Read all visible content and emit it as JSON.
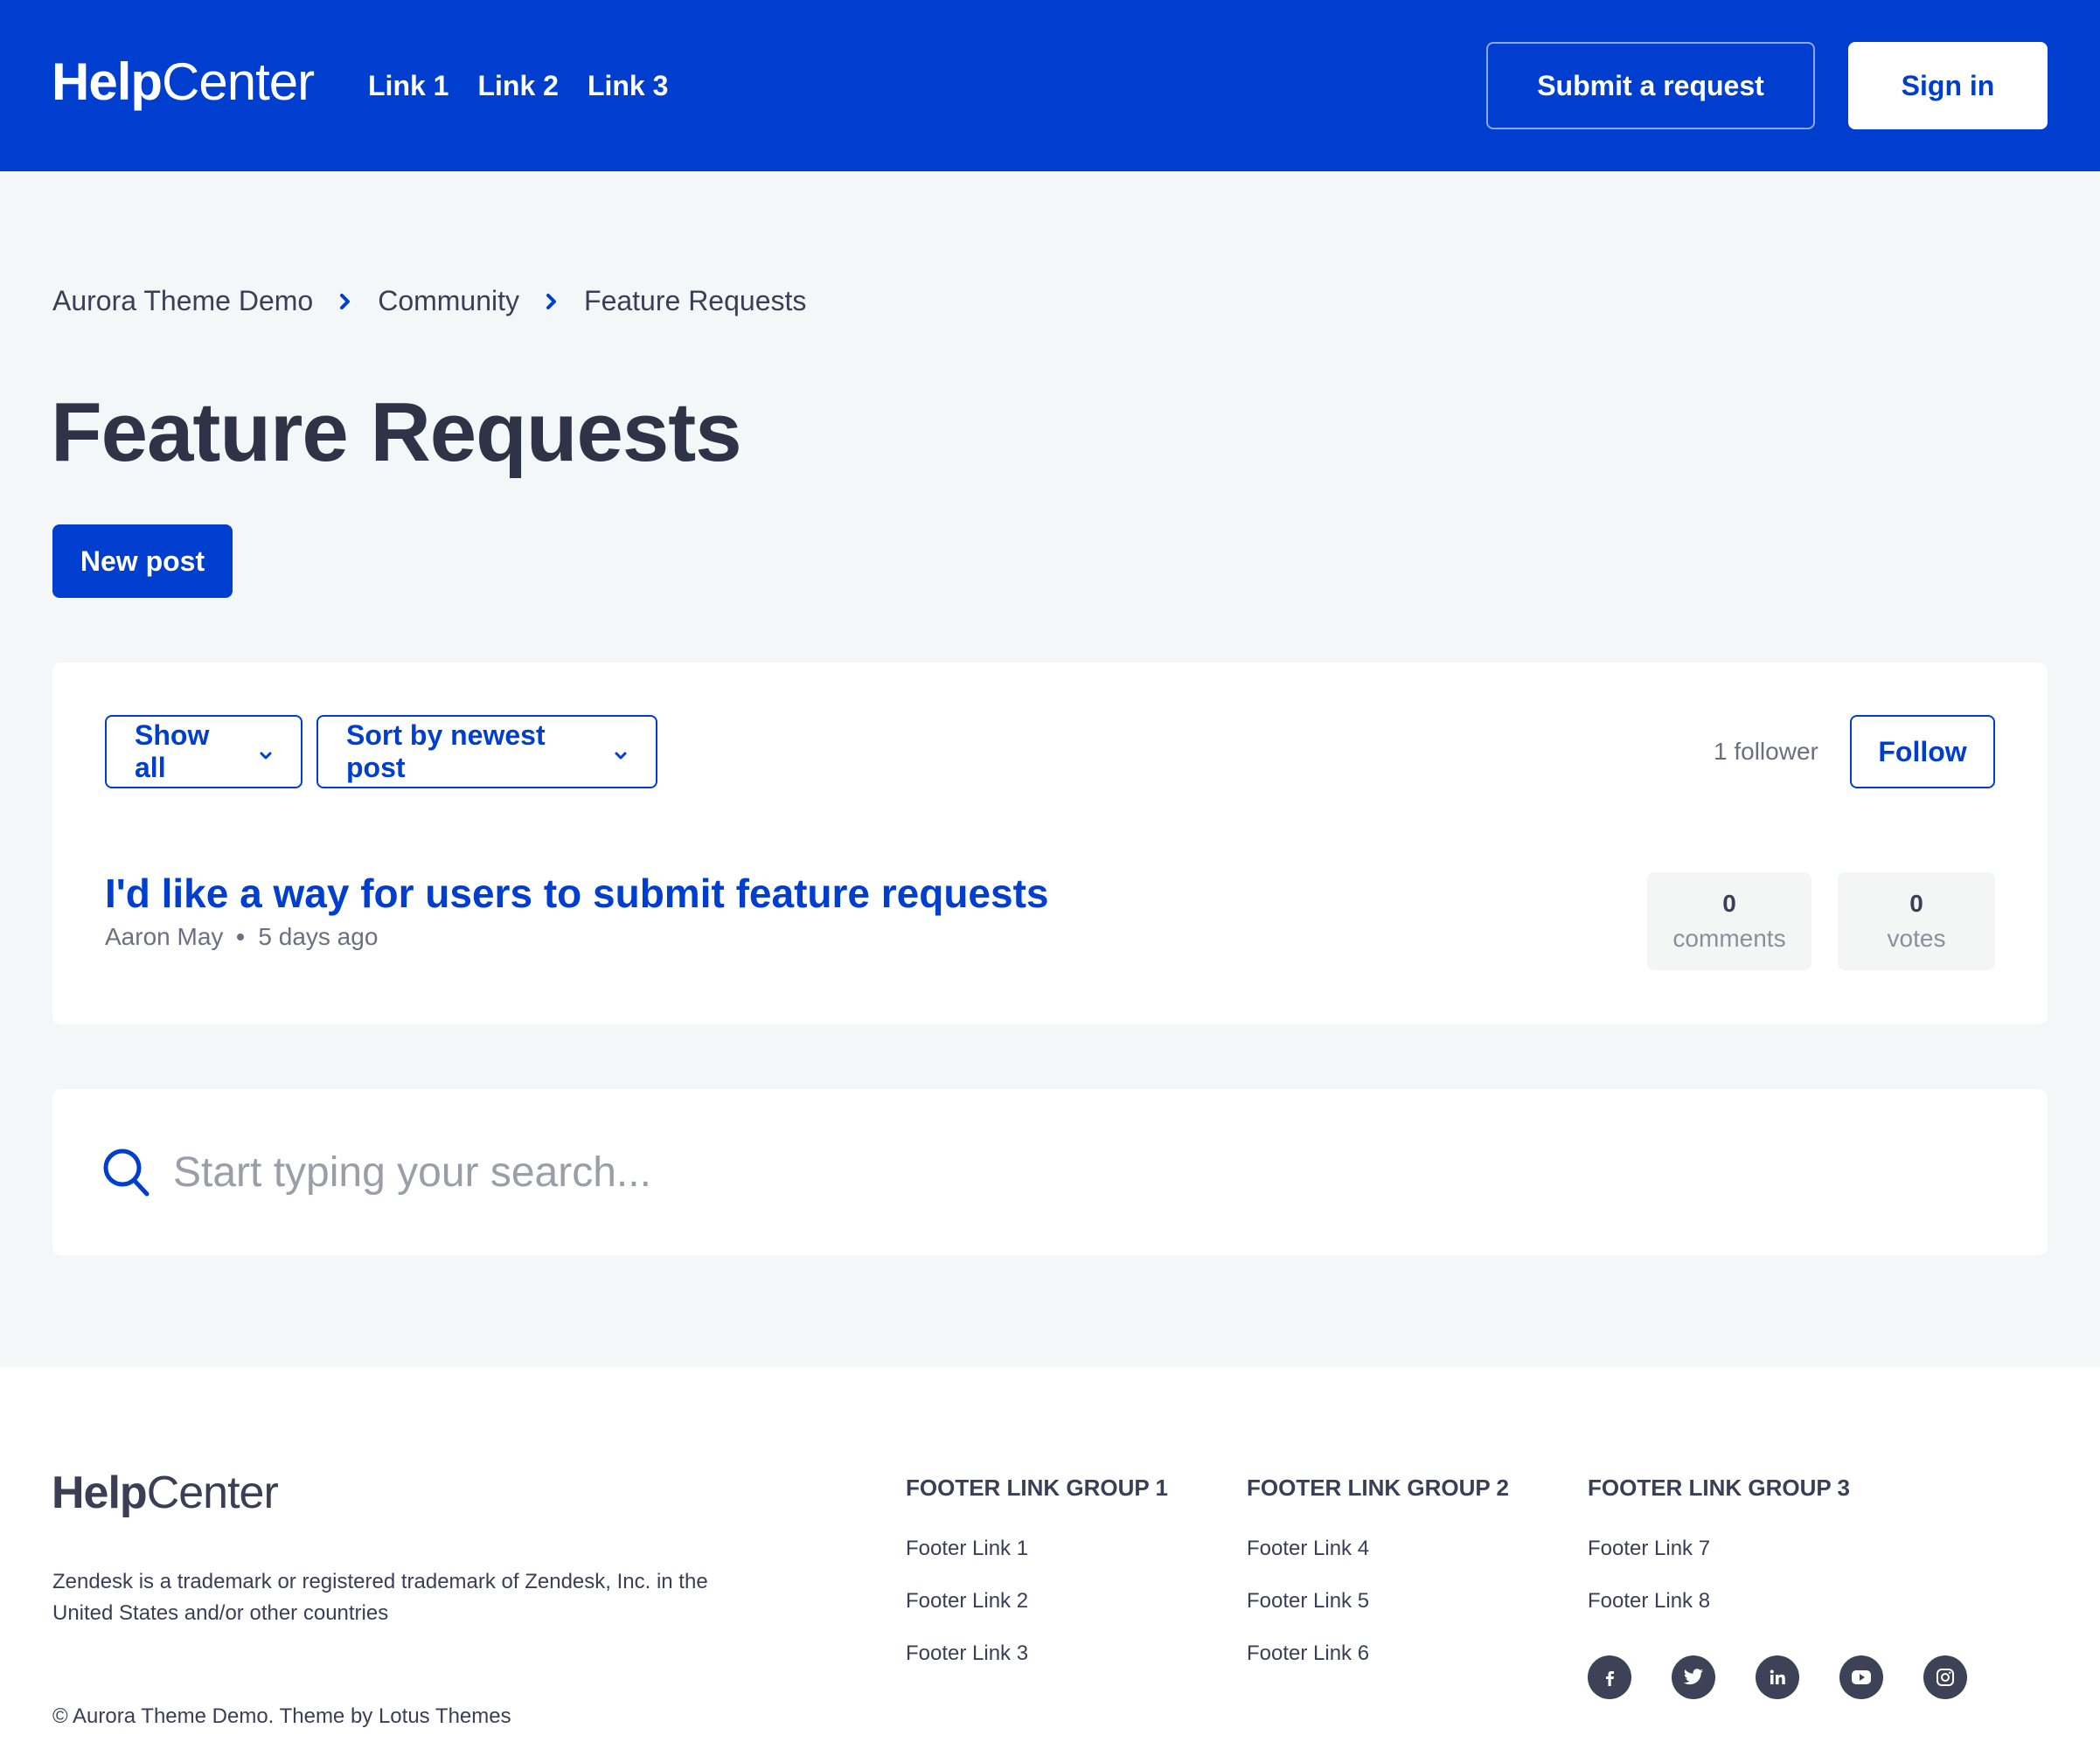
{
  "header": {
    "logo_bold": "Help",
    "logo_light": "Center",
    "nav": [
      "Link 1",
      "Link 2",
      "Link 3"
    ],
    "submit_label": "Submit a request",
    "signin_label": "Sign in",
    "bg_color": "#003ecf"
  },
  "breadcrumb": [
    "Aurora Theme Demo",
    "Community",
    "Feature Requests"
  ],
  "page": {
    "title": "Feature Requests",
    "new_post_label": "New post"
  },
  "filters": {
    "show_label": "Show all",
    "sort_label": "Sort by newest post",
    "followers": "1 follower",
    "follow_label": "Follow"
  },
  "posts": [
    {
      "title": "I'd like a way for users to submit feature requests",
      "author": "Aaron May",
      "time": "5 days ago",
      "comments_count": "0",
      "comments_label": "comments",
      "votes_count": "0",
      "votes_label": "votes"
    }
  ],
  "search": {
    "placeholder": "Start typing your search..."
  },
  "footer": {
    "logo_bold": "Help",
    "logo_light": "Center",
    "description": "Zendesk is a trademark or registered trademark of Zendesk, Inc. in the United States and/or other countries",
    "copyright": "© Aurora Theme Demo. Theme by Lotus Themes",
    "groups": [
      {
        "title": "FOOTER LINK GROUP 1",
        "links": [
          "Footer Link 1",
          "Footer Link 2",
          "Footer Link 3"
        ]
      },
      {
        "title": "FOOTER LINK GROUP 2",
        "links": [
          "Footer Link 4",
          "Footer Link 5",
          "Footer Link 6"
        ]
      },
      {
        "title": "FOOTER LINK GROUP 3",
        "links": [
          "Footer Link 7",
          "Footer Link 8"
        ]
      }
    ],
    "socials": [
      "facebook-icon",
      "twitter-icon",
      "linkedin-icon",
      "youtube-icon",
      "instagram-icon"
    ]
  }
}
